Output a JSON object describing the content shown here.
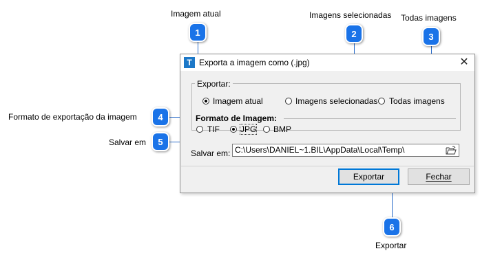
{
  "callouts": [
    {
      "number": "1",
      "text": "Imagem atual"
    },
    {
      "number": "2",
      "text": "Imagens selecionadas"
    },
    {
      "number": "3",
      "text": "Todas imagens"
    },
    {
      "number": "4",
      "text": "Formato de exportação da imagem"
    },
    {
      "number": "5",
      "text": "Salvar em"
    },
    {
      "number": "6",
      "text": "Exportar"
    }
  ],
  "dialog": {
    "title": "Exporta a imagem como (.jpg)",
    "app_icon_letter": "T",
    "close_glyph": "✕",
    "export_group": {
      "legend": "Exportar:",
      "options": [
        {
          "label": "Imagem atual",
          "selected": true
        },
        {
          "label": "Imagens selecionadas",
          "selected": false
        },
        {
          "label": "Todas imagens",
          "selected": false
        }
      ]
    },
    "format": {
      "title": "Formato de Imagem:",
      "options": [
        {
          "label": "TIF",
          "selected": false
        },
        {
          "label": "JPG",
          "selected": true
        },
        {
          "label": "BMP",
          "selected": false
        }
      ]
    },
    "save": {
      "label": "Salvar em:",
      "path": "C:\\Users\\DANIEL~1.BIL\\AppData\\Local\\Temp\\"
    },
    "buttons": {
      "export": "Exportar",
      "close": "Fechar"
    }
  },
  "colors": {
    "badge": "#1a73e8",
    "connector": "#2a6cc9",
    "app_icon": "#1c78c8",
    "dialog_bg": "#f0f0f0"
  }
}
